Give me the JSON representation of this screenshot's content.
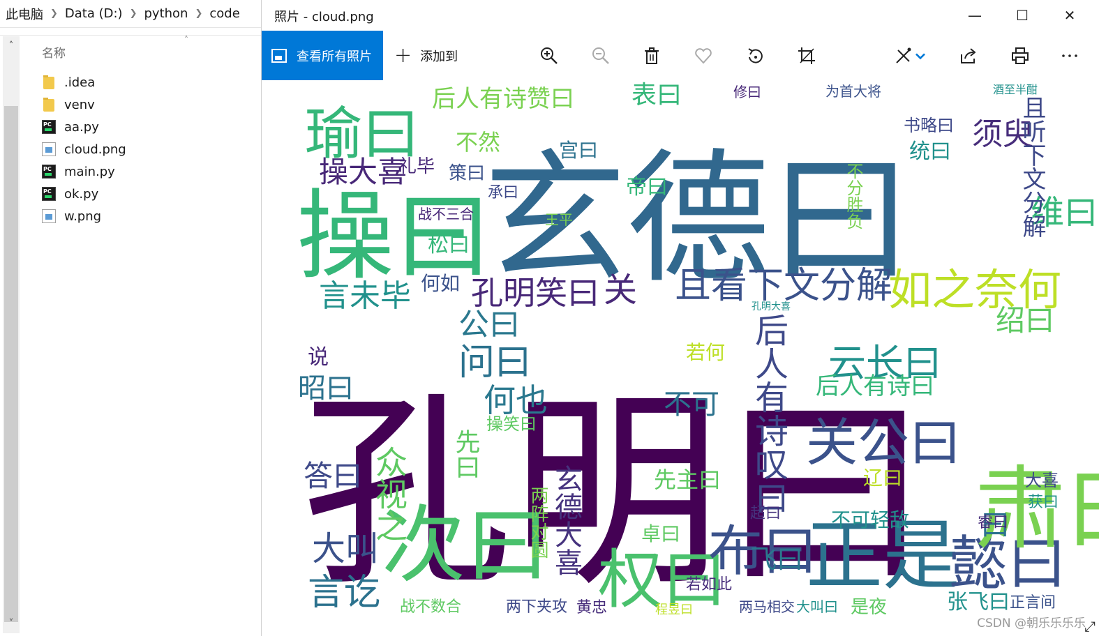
{
  "explorer": {
    "breadcrumb": [
      "此电脑",
      "Data (D:)",
      "python",
      "code"
    ],
    "column_header": "名称",
    "files": [
      {
        "name": ".idea",
        "kind": "folder-icon"
      },
      {
        "name": "venv",
        "kind": "folder-icon"
      },
      {
        "name": "aa.py",
        "kind": "pycharm-file-icon"
      },
      {
        "name": "cloud.png",
        "kind": "image-file-icon"
      },
      {
        "name": "main.py",
        "kind": "pycharm-file-icon"
      },
      {
        "name": "ok.py",
        "kind": "pycharm-file-icon"
      },
      {
        "name": "w.png",
        "kind": "image-file-icon"
      }
    ]
  },
  "photos": {
    "title": "照片 - cloud.png",
    "view_all_label": "查看所有照片",
    "add_to_label": "添加到",
    "accent_color": "#0078d7",
    "tools": [
      "zoom-in-icon",
      "zoom-out-icon",
      "delete-icon",
      "favorite-icon",
      "rotate-icon",
      "crop-icon",
      "edit-icon",
      "share-icon",
      "print-icon",
      "more-icon"
    ],
    "watermark": "CSDN @朝乐乐乐乐",
    "wordcloud_palette": [
      "#440154",
      "#3b528b",
      "#21918c",
      "#5ec962",
      "#fde725"
    ],
    "wordcloud": [
      {
        "w": "孔明曰",
        "c": "#440154"
      },
      {
        "w": "玄德曰",
        "c": "#31688e"
      },
      {
        "w": "操曰",
        "c": "#35b779"
      },
      {
        "w": "次曰",
        "c": "#4ac16d"
      },
      {
        "w": "正是",
        "c": "#2c728e"
      },
      {
        "w": "懿曰",
        "c": "#3b528b"
      },
      {
        "w": "权曰",
        "c": "#4ac16d"
      },
      {
        "w": "布曰",
        "c": "#3b528b"
      },
      {
        "w": "肃曰",
        "c": "#7ad151"
      },
      {
        "w": "瑜曰",
        "c": "#35b779"
      },
      {
        "w": "如之奈何",
        "c": "#bddf26"
      },
      {
        "w": "且看下文分解",
        "c": "#3b528b"
      },
      {
        "w": "关公曰",
        "c": "#3b528b"
      },
      {
        "w": "后人有诗叹曰",
        "c": "#3e4989"
      },
      {
        "w": "云长曰",
        "c": "#21918c"
      },
      {
        "w": "后人有诗赞曰",
        "c": "#7ad151"
      },
      {
        "w": "孔明笑曰",
        "c": "#482878"
      },
      {
        "w": "维曰",
        "c": "#35b779"
      },
      {
        "w": "须臾",
        "c": "#472d7b"
      },
      {
        "w": "且听下文分解",
        "c": "#3e4989"
      },
      {
        "w": "言未毕",
        "c": "#21918c"
      },
      {
        "w": "操大喜",
        "c": "#482878"
      },
      {
        "w": "问曰",
        "c": "#2c728e"
      },
      {
        "w": "何也",
        "c": "#2a788e"
      },
      {
        "w": "答曰",
        "c": "#3e4989"
      },
      {
        "w": "大叫",
        "c": "#3b528b"
      },
      {
        "w": "言讫",
        "c": "#2c728e"
      },
      {
        "w": "众视之",
        "c": "#5ec962"
      },
      {
        "w": "玄德大喜",
        "c": "#46337e"
      },
      {
        "w": "表曰",
        "c": "#35b779"
      },
      {
        "w": "公曰",
        "c": "#2a788e"
      },
      {
        "w": "昭曰",
        "c": "#2c728e"
      },
      {
        "w": "绍曰",
        "c": "#5ec962"
      },
      {
        "w": "不可",
        "c": "#2c728e"
      },
      {
        "w": "后人有诗曰",
        "c": "#35b779"
      },
      {
        "w": "不然",
        "c": "#7ad151"
      },
      {
        "w": "统曰",
        "c": "#21918c"
      },
      {
        "w": "书略曰",
        "c": "#3e4989"
      },
      {
        "w": "关",
        "c": "#482878"
      },
      {
        "w": "不可轻敌",
        "c": "#21918c"
      },
      {
        "w": "辽曰",
        "c": "#bddf26"
      },
      {
        "w": "张飞曰",
        "c": "#21918c"
      },
      {
        "w": "飞曰",
        "c": "#2a788e"
      },
      {
        "w": "超曰",
        "c": "#46337e"
      },
      {
        "w": "曰",
        "c": "#2c728e"
      },
      {
        "w": "先主曰",
        "c": "#5ec962"
      },
      {
        "w": "两阵对圆",
        "c": "#7ad151"
      },
      {
        "w": "若何",
        "c": "#bddf26"
      },
      {
        "w": "先曰",
        "c": "#5ec962"
      },
      {
        "w": "宫曰",
        "c": "#2c728e"
      },
      {
        "w": "帝曰",
        "c": "#35b779"
      },
      {
        "w": "松曰",
        "c": "#35b779"
      },
      {
        "w": "礼毕",
        "c": "#482878"
      },
      {
        "w": "策曰",
        "c": "#3b528b"
      },
      {
        "w": "何如",
        "c": "#3b528b"
      },
      {
        "w": "说",
        "c": "#482878"
      },
      {
        "w": "大喜",
        "c": "#3e4989"
      },
      {
        "w": "获曰",
        "c": "#21918c"
      },
      {
        "w": "睿曰",
        "c": "#472d7b"
      },
      {
        "w": "操笑曰",
        "c": "#5ec962"
      },
      {
        "w": "两下夹攻",
        "c": "#3e4989"
      },
      {
        "w": "战不数合",
        "c": "#5ec962"
      },
      {
        "w": "若如此",
        "c": "#472d7b"
      },
      {
        "w": "两马相交",
        "c": "#3e4989"
      },
      {
        "w": "大叫曰",
        "c": "#21918c"
      },
      {
        "w": "是夜",
        "c": "#5ec962"
      },
      {
        "w": "正言间",
        "c": "#3b528b"
      },
      {
        "w": "卓曰",
        "c": "#5ec962"
      },
      {
        "w": "黄忠",
        "c": "#472d7b"
      },
      {
        "w": "程昱曰",
        "c": "#bddf26"
      },
      {
        "w": "战不三合",
        "c": "#482878"
      },
      {
        "w": "承曰",
        "c": "#3e4989"
      },
      {
        "w": "王平",
        "c": "#7ad151"
      },
      {
        "w": "孔明大喜",
        "c": "#21918c"
      },
      {
        "w": "不分胜负",
        "c": "#7ad151"
      },
      {
        "w": "修曰",
        "c": "#482878"
      },
      {
        "w": "为首大将",
        "c": "#3b528b"
      },
      {
        "w": "酒至半酣",
        "c": "#21918c"
      }
    ]
  }
}
